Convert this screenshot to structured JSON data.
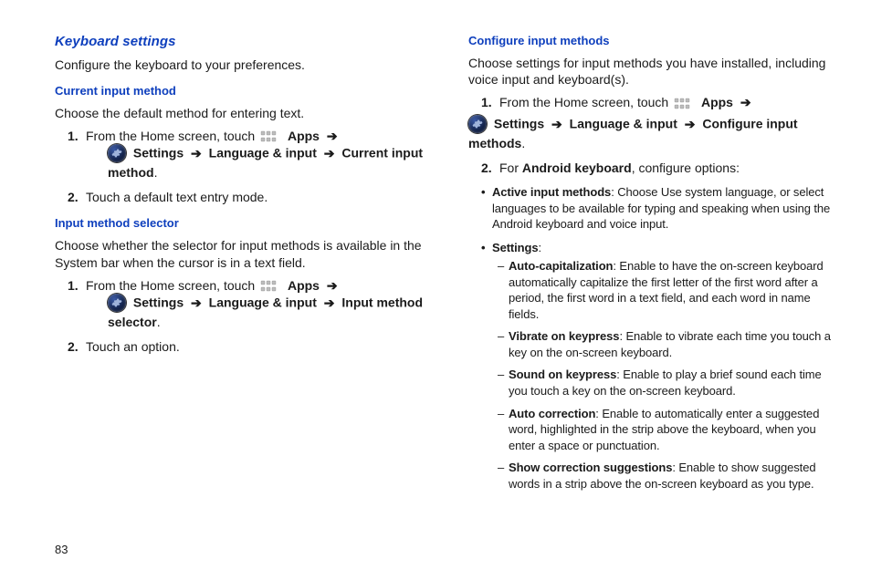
{
  "page_number": "83",
  "left": {
    "h_section": "Keyboard settings",
    "intro": "Configure the keyboard to your preferences.",
    "sec1": {
      "h_sub": "Current input method",
      "intro": "Choose the default method for entering text.",
      "steps": [
        {
          "prefix": "From the Home screen, touch ",
          "apps": "Apps",
          "line2_settings": "Settings",
          "line2_a": "Language & input",
          "line2_b": "Current input method"
        },
        {
          "text": "Touch a default text entry mode."
        }
      ]
    },
    "sec2": {
      "h_sub": "Input method selector",
      "intro": "Choose whether the selector for input methods is available in the System bar when the cursor is in a text field.",
      "steps": [
        {
          "prefix": "From the Home screen, touch ",
          "apps": "Apps",
          "line2_settings": "Settings",
          "line2_a": "Language & input",
          "line2_b": "Input method selector"
        },
        {
          "text": "Touch an option."
        }
      ]
    }
  },
  "right": {
    "h_sub": "Configure input methods",
    "intro": "Choose settings for input methods you have installed, including voice input and keyboard(s).",
    "step1": {
      "prefix": "From the Home screen, touch ",
      "apps": "Apps",
      "line2_settings": "Settings",
      "line2_a": "Language & input",
      "line2_b": "Configure input methods"
    },
    "step2_prefix": "For ",
    "step2_bold": "Android keyboard",
    "step2_suffix": ", configure options:",
    "bullets": [
      {
        "label": "Active input methods",
        "text": ": Choose Use system language, or select languages to be available for typing and speaking when using the Android keyboard and voice input."
      },
      {
        "label": "Settings",
        "text": ":",
        "dash": [
          {
            "label": "Auto-capitalization",
            "text": ": Enable to have the on-screen keyboard automatically capitalize the first letter of the first word after a period, the first word in a text field, and each word in name fields."
          },
          {
            "label": "Vibrate on keypress",
            "text": ": Enable to vibrate each time you touch a key on the on-screen keyboard."
          },
          {
            "label": "Sound on keypress",
            "text": ": Enable to play a brief sound each time you touch a key on the on-screen keyboard."
          },
          {
            "label": "Auto correction",
            "text": ": Enable to automatically enter a suggested word, highlighted in the strip above the keyboard, when you enter a space or punctuation."
          },
          {
            "label": "Show correction suggestions",
            "text": ": Enable to show suggested words in a strip above the on-screen keyboard as you type."
          }
        ]
      }
    ]
  },
  "arrow": "➔"
}
